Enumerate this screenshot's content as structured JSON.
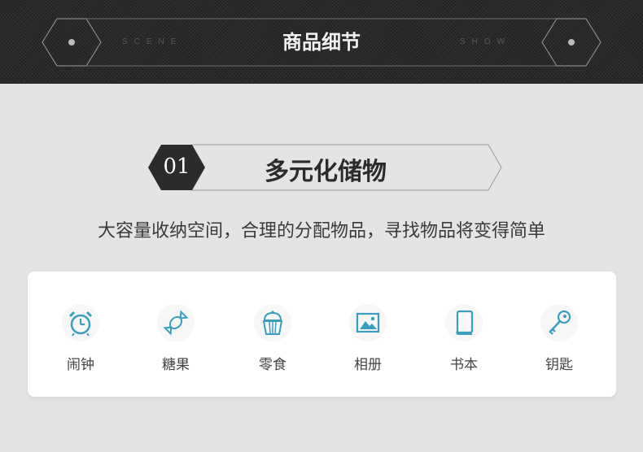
{
  "header": {
    "title": "商品细节",
    "left_word": "SCENE",
    "right_word": "SHOW",
    "bg_color": "#2a2a2a"
  },
  "section": {
    "number": "01",
    "title": "多元化储物"
  },
  "subtitle": "大容量收纳空间，合理的分配物品，寻找物品将变得简单",
  "accent_color": "#3a9fbf",
  "items": [
    {
      "label": "闹钟",
      "icon": "alarm-clock-icon"
    },
    {
      "label": "糖果",
      "icon": "candy-icon"
    },
    {
      "label": "零食",
      "icon": "cupcake-icon"
    },
    {
      "label": "相册",
      "icon": "photo-album-icon"
    },
    {
      "label": "书本",
      "icon": "book-icon"
    },
    {
      "label": "钥匙",
      "icon": "key-icon"
    }
  ]
}
